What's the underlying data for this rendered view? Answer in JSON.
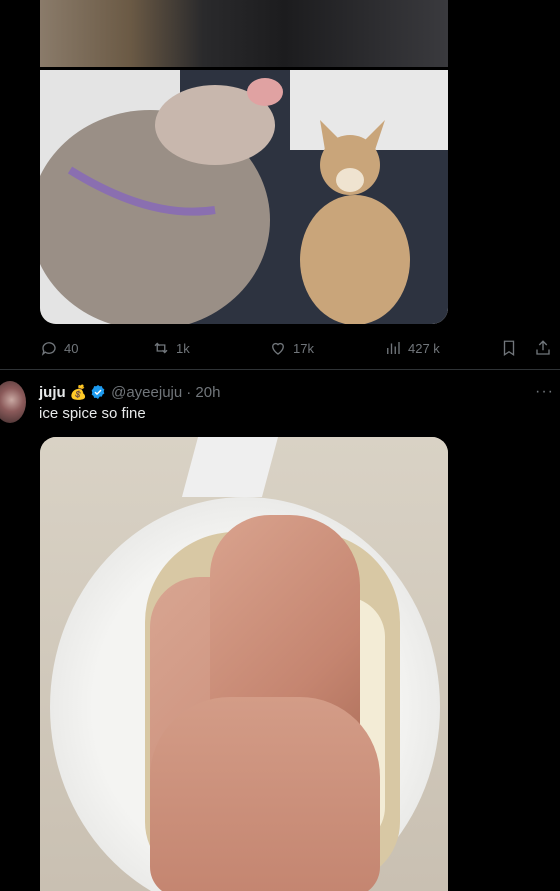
{
  "tweet1": {
    "actions": {
      "replies": "40",
      "reposts": "1k",
      "likes": "17k",
      "views": "427 k"
    }
  },
  "tweet2": {
    "name": "juju",
    "name_emoji": "💰",
    "handle": "@ayeejuju",
    "time": "· 20h",
    "text": "ice spice so fine",
    "more": "···"
  },
  "colors": {
    "background": "#000000",
    "text": "#e7e9ea",
    "secondary": "#71767b",
    "verified": "#1d9bf0",
    "divider": "#2f3336"
  }
}
